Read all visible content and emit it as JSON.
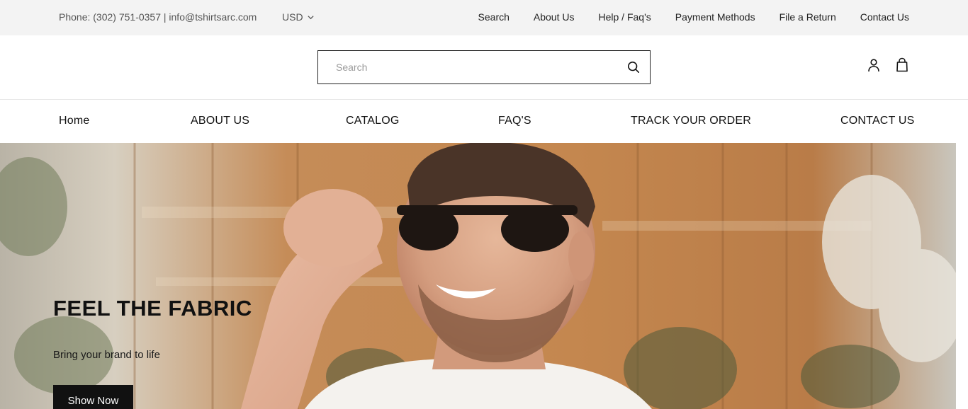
{
  "topbar": {
    "contact_text": "Phone: (302) 751-0357 | info@tshirtsarc.com",
    "currency": "USD",
    "links": [
      "Search",
      "About Us",
      "Help / Faq's",
      "Payment Methods",
      "File a Return",
      "Contact Us"
    ]
  },
  "header": {
    "search_placeholder": "Search",
    "icons": [
      "search-icon",
      "account-icon",
      "shopping-bag-icon"
    ]
  },
  "nav": {
    "items": [
      "Home",
      "ABOUT US",
      "CATALOG",
      "FAQ'S",
      "TRACK YOUR ORDER",
      "CONTACT US"
    ]
  },
  "hero": {
    "title": "FEEL THE FABRIC",
    "subtitle": "Bring your brand to life",
    "cta_label": "Show Now"
  },
  "colors": {
    "topbar_bg": "#f3f3f3",
    "cta_bg": "#111111",
    "text": "#111111"
  }
}
